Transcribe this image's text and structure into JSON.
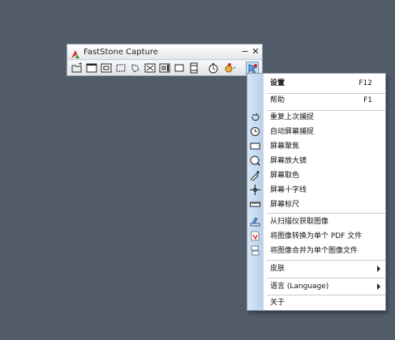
{
  "window": {
    "title": "FastStone Capture",
    "minimize_glyph": "−",
    "close_glyph": "✕"
  },
  "toolbar": {
    "tools": [
      "open-icon",
      "capture-active-window-icon",
      "capture-window-object-icon",
      "capture-rectangle-icon",
      "capture-freehand-icon",
      "capture-fullscreen-icon",
      "capture-scrolling-icon",
      "capture-fixed-region-icon",
      "screen-recorder-icon",
      "delay-timer-icon",
      "output-destination-icon",
      "settings-menu-icon"
    ]
  },
  "menu": {
    "settings": {
      "label": "设置",
      "shortcut": "F12"
    },
    "help": {
      "label": "帮助",
      "shortcut": "F1"
    },
    "repeat_last": {
      "label": "重复上次捕捉"
    },
    "auto_capture": {
      "label": "自动屏幕捕捉"
    },
    "screen_focus": {
      "label": "屏幕聚焦"
    },
    "magnifier": {
      "label": "屏幕放大镜"
    },
    "color_picker": {
      "label": "屏幕取色"
    },
    "crosshair": {
      "label": "屏幕十字线"
    },
    "ruler": {
      "label": "屏幕标尺"
    },
    "from_scanner": {
      "label": "从扫描仪获取图像"
    },
    "to_pdf": {
      "label": "将图像转换为单个 PDF 文件"
    },
    "combine_images": {
      "label": "将图像合并为单个图像文件"
    },
    "skin": {
      "label": "皮肤"
    },
    "language": {
      "label": "语言 (Language)"
    },
    "about": {
      "label": "关于"
    }
  },
  "colors": {
    "desktop": "#525c68",
    "menu_gutter": "#c6d9ef",
    "logo_red": "#d8281e",
    "logo_green": "#2e8b3a"
  }
}
